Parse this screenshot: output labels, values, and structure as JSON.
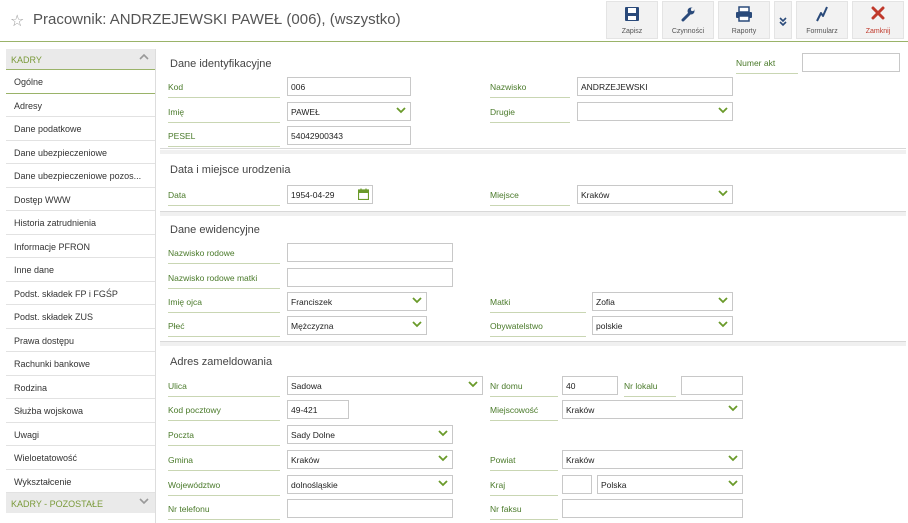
{
  "header": {
    "title": "Pracownik: ANDRZEJEWSKI PAWEŁ (006), (wszystko)",
    "buttons": {
      "save": "Zapisz",
      "actions": "Czynności",
      "reports": "Raporty",
      "form": "Formularz",
      "close": "Zamknij"
    }
  },
  "colors": {
    "accent": "#9ab369",
    "label": "#4a7a2a",
    "chevron": "#6a9a2a",
    "close": "#c0392b"
  },
  "sidebar": {
    "section": "KADRY",
    "items": [
      "Ogólne",
      "Adresy",
      "Dane podatkowe",
      "Dane ubezpieczeniowe",
      "Dane ubezpieczeniowe pozos...",
      "Dostęp WWW",
      "Historia zatrudnienia",
      "Informacje PFRON",
      "Inne dane",
      "Podst. składek FP i FGŚP",
      "Podst. składek ZUS",
      "Prawa dostępu",
      "Rachunki bankowe",
      "Rodzina",
      "Służba wojskowa",
      "Uwagi",
      "Wieloetatowość",
      "Wykształcenie"
    ],
    "footer": "KADRY - POZOSTAŁE"
  },
  "identification": {
    "title": "Dane identyfikacyjne",
    "numer_akt_label": "Numer akt",
    "numer_akt": "",
    "kod_label": "Kod",
    "kod": "006",
    "nazwisko_label": "Nazwisko",
    "nazwisko": "ANDRZEJEWSKI",
    "imie_label": "Imię",
    "imie": "PAWEŁ",
    "drugie_label": "Drugie",
    "drugie": "",
    "pesel_label": "PESEL",
    "pesel": "54042900343"
  },
  "birth": {
    "title": "Data i miejsce urodzenia",
    "data_label": "Data",
    "data": "1954-04-29",
    "miejsce_label": "Miejsce",
    "miejsce": "Kraków"
  },
  "records": {
    "title": "Dane ewidencyjne",
    "nazwisko_rodowe_label": "Nazwisko rodowe",
    "nazwisko_rodowe": "",
    "nazwisko_rodowe_matki_label": "Nazwisko rodowe matki",
    "nazwisko_rodowe_matki": "",
    "imie_ojca_label": "Imię ojca",
    "imie_ojca": "Franciszek",
    "matki_label": "Matki",
    "matki": "Zofia",
    "plec_label": "Płeć",
    "plec": "Mężczyzna",
    "obywatelstwo_label": "Obywatelstwo",
    "obywatelstwo": "polskie"
  },
  "address": {
    "title": "Adres zameldowania",
    "ulica_label": "Ulica",
    "ulica": "Sadowa",
    "nr_domu_label": "Nr domu",
    "nr_domu": "40",
    "nr_lokalu_label": "Nr lokalu",
    "nr_lokalu": "",
    "kod_label": "Kod pocztowy",
    "kod": "49-421",
    "miejscowosc_label": "Miejscowość",
    "miejscowosc": "Kraków",
    "poczta_label": "Poczta",
    "poczta": "Sady Dolne",
    "gmina_label": "Gmina",
    "gmina": "Kraków",
    "powiat_label": "Powiat",
    "powiat": "Kraków",
    "wojewodztwo_label": "Województwo",
    "wojewodztwo": "dolnośląskie",
    "kraj_label": "Kraj",
    "kraj_code": "",
    "kraj": "Polska",
    "telefon_label": "Nr telefonu",
    "telefon": "",
    "faks_label": "Nr faksu",
    "faks": ""
  }
}
